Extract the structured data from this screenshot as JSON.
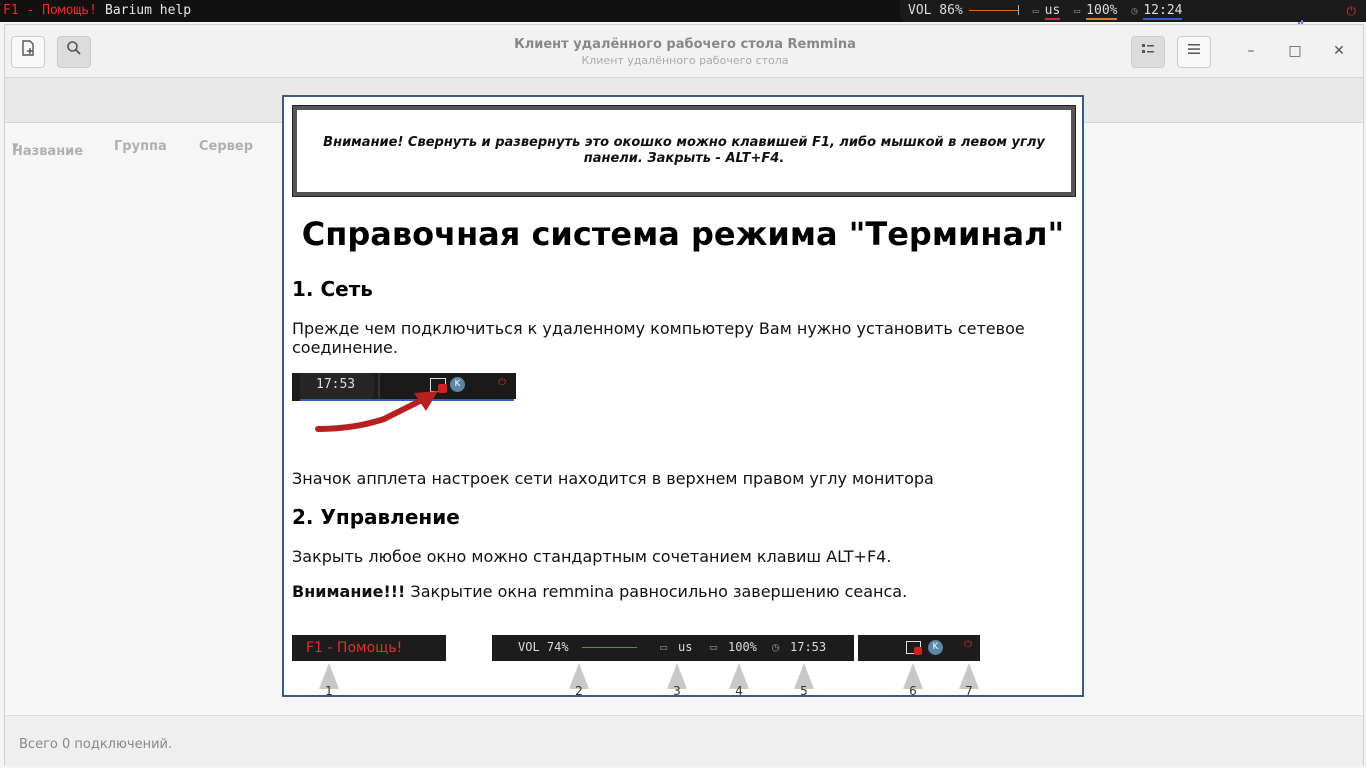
{
  "topbar": {
    "f1_label": "F1 - Помощь!",
    "window_title": "Barium help",
    "volume": "VOL 86%",
    "keyboard_layout": "us",
    "battery": "100%",
    "clock": "12:24"
  },
  "window": {
    "title": "Клиент удалённого рабочего стола Remmina",
    "subtitle": "Клиент удалённого рабочего стола",
    "columns": [
      "Название",
      "Группа",
      "Сервер"
    ],
    "status": "Всего 0 подключений."
  },
  "help": {
    "notice": "Внимание! Свернуть и развернуть это окошко можно клавишей F1, либо мышкой в левом углу панели. Закрыть - ALT+F4.",
    "title": "Справочная система режима \"Терминал\"",
    "section1_heading": "1. Сеть",
    "section1_text": "Прежде чем подключиться к удаленному компьютеру Вам нужно установить сетевое соединение.",
    "illustration1_clock": "17:53",
    "section1_caption": "Значок апплета настроек сети находится в верхнем правом углу монитора",
    "section2_heading": "2. Управление",
    "section2_text": "Закрыть любое окно можно стандартным сочетанием клавиш ALT+F4.",
    "warning_bold": "Внимание!!!",
    "warning_text": " Закрытие окна remmina равносильно завершению сеанса.",
    "illustration2": {
      "f1_label": "F1 - Помощь!",
      "volume": "VOL 74%",
      "layout": "us",
      "battery": "100%",
      "clock": "17:53"
    },
    "pins": [
      "1",
      "2",
      "3",
      "4",
      "5",
      "6",
      "7"
    ]
  }
}
